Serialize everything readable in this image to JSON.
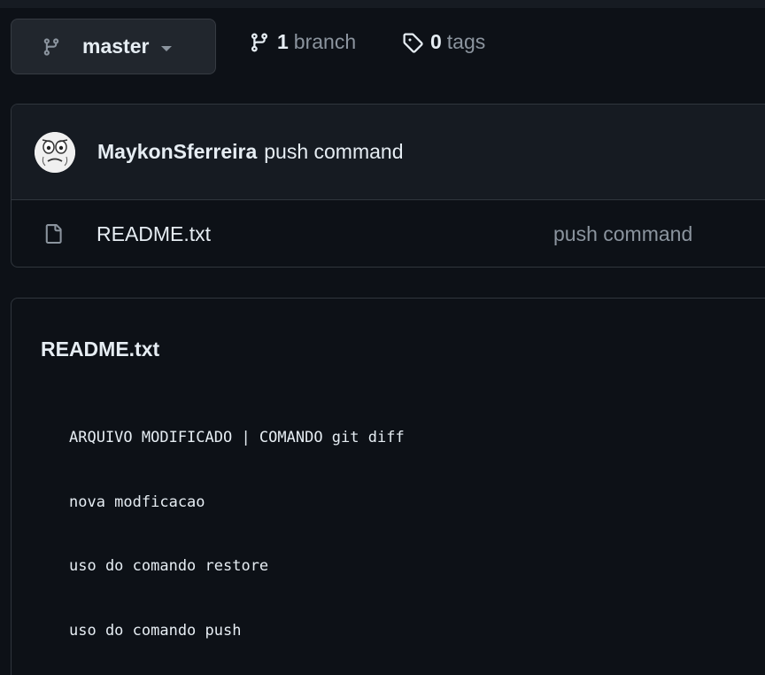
{
  "branch_selector": {
    "current_branch": "master",
    "icon": "git-branch-icon"
  },
  "repo_meta": {
    "branches_count": "1",
    "branches_label": "branch",
    "tags_count": "0",
    "tags_label": "tags"
  },
  "latest_commit": {
    "author": "MaykonSferreira",
    "message": "push command"
  },
  "files": [
    {
      "name": "README.txt",
      "commit_message": "push command",
      "icon": "file-icon"
    }
  ],
  "readme": {
    "title": "README.txt",
    "lines": [
      "ARQUIVO MODIFICADO | COMANDO git diff",
      "nova modficacao",
      "uso do comando restore",
      "uso do comando push"
    ]
  },
  "colors": {
    "background": "#0d1117",
    "muted_text": "#8b949e",
    "border": "#30363d"
  }
}
